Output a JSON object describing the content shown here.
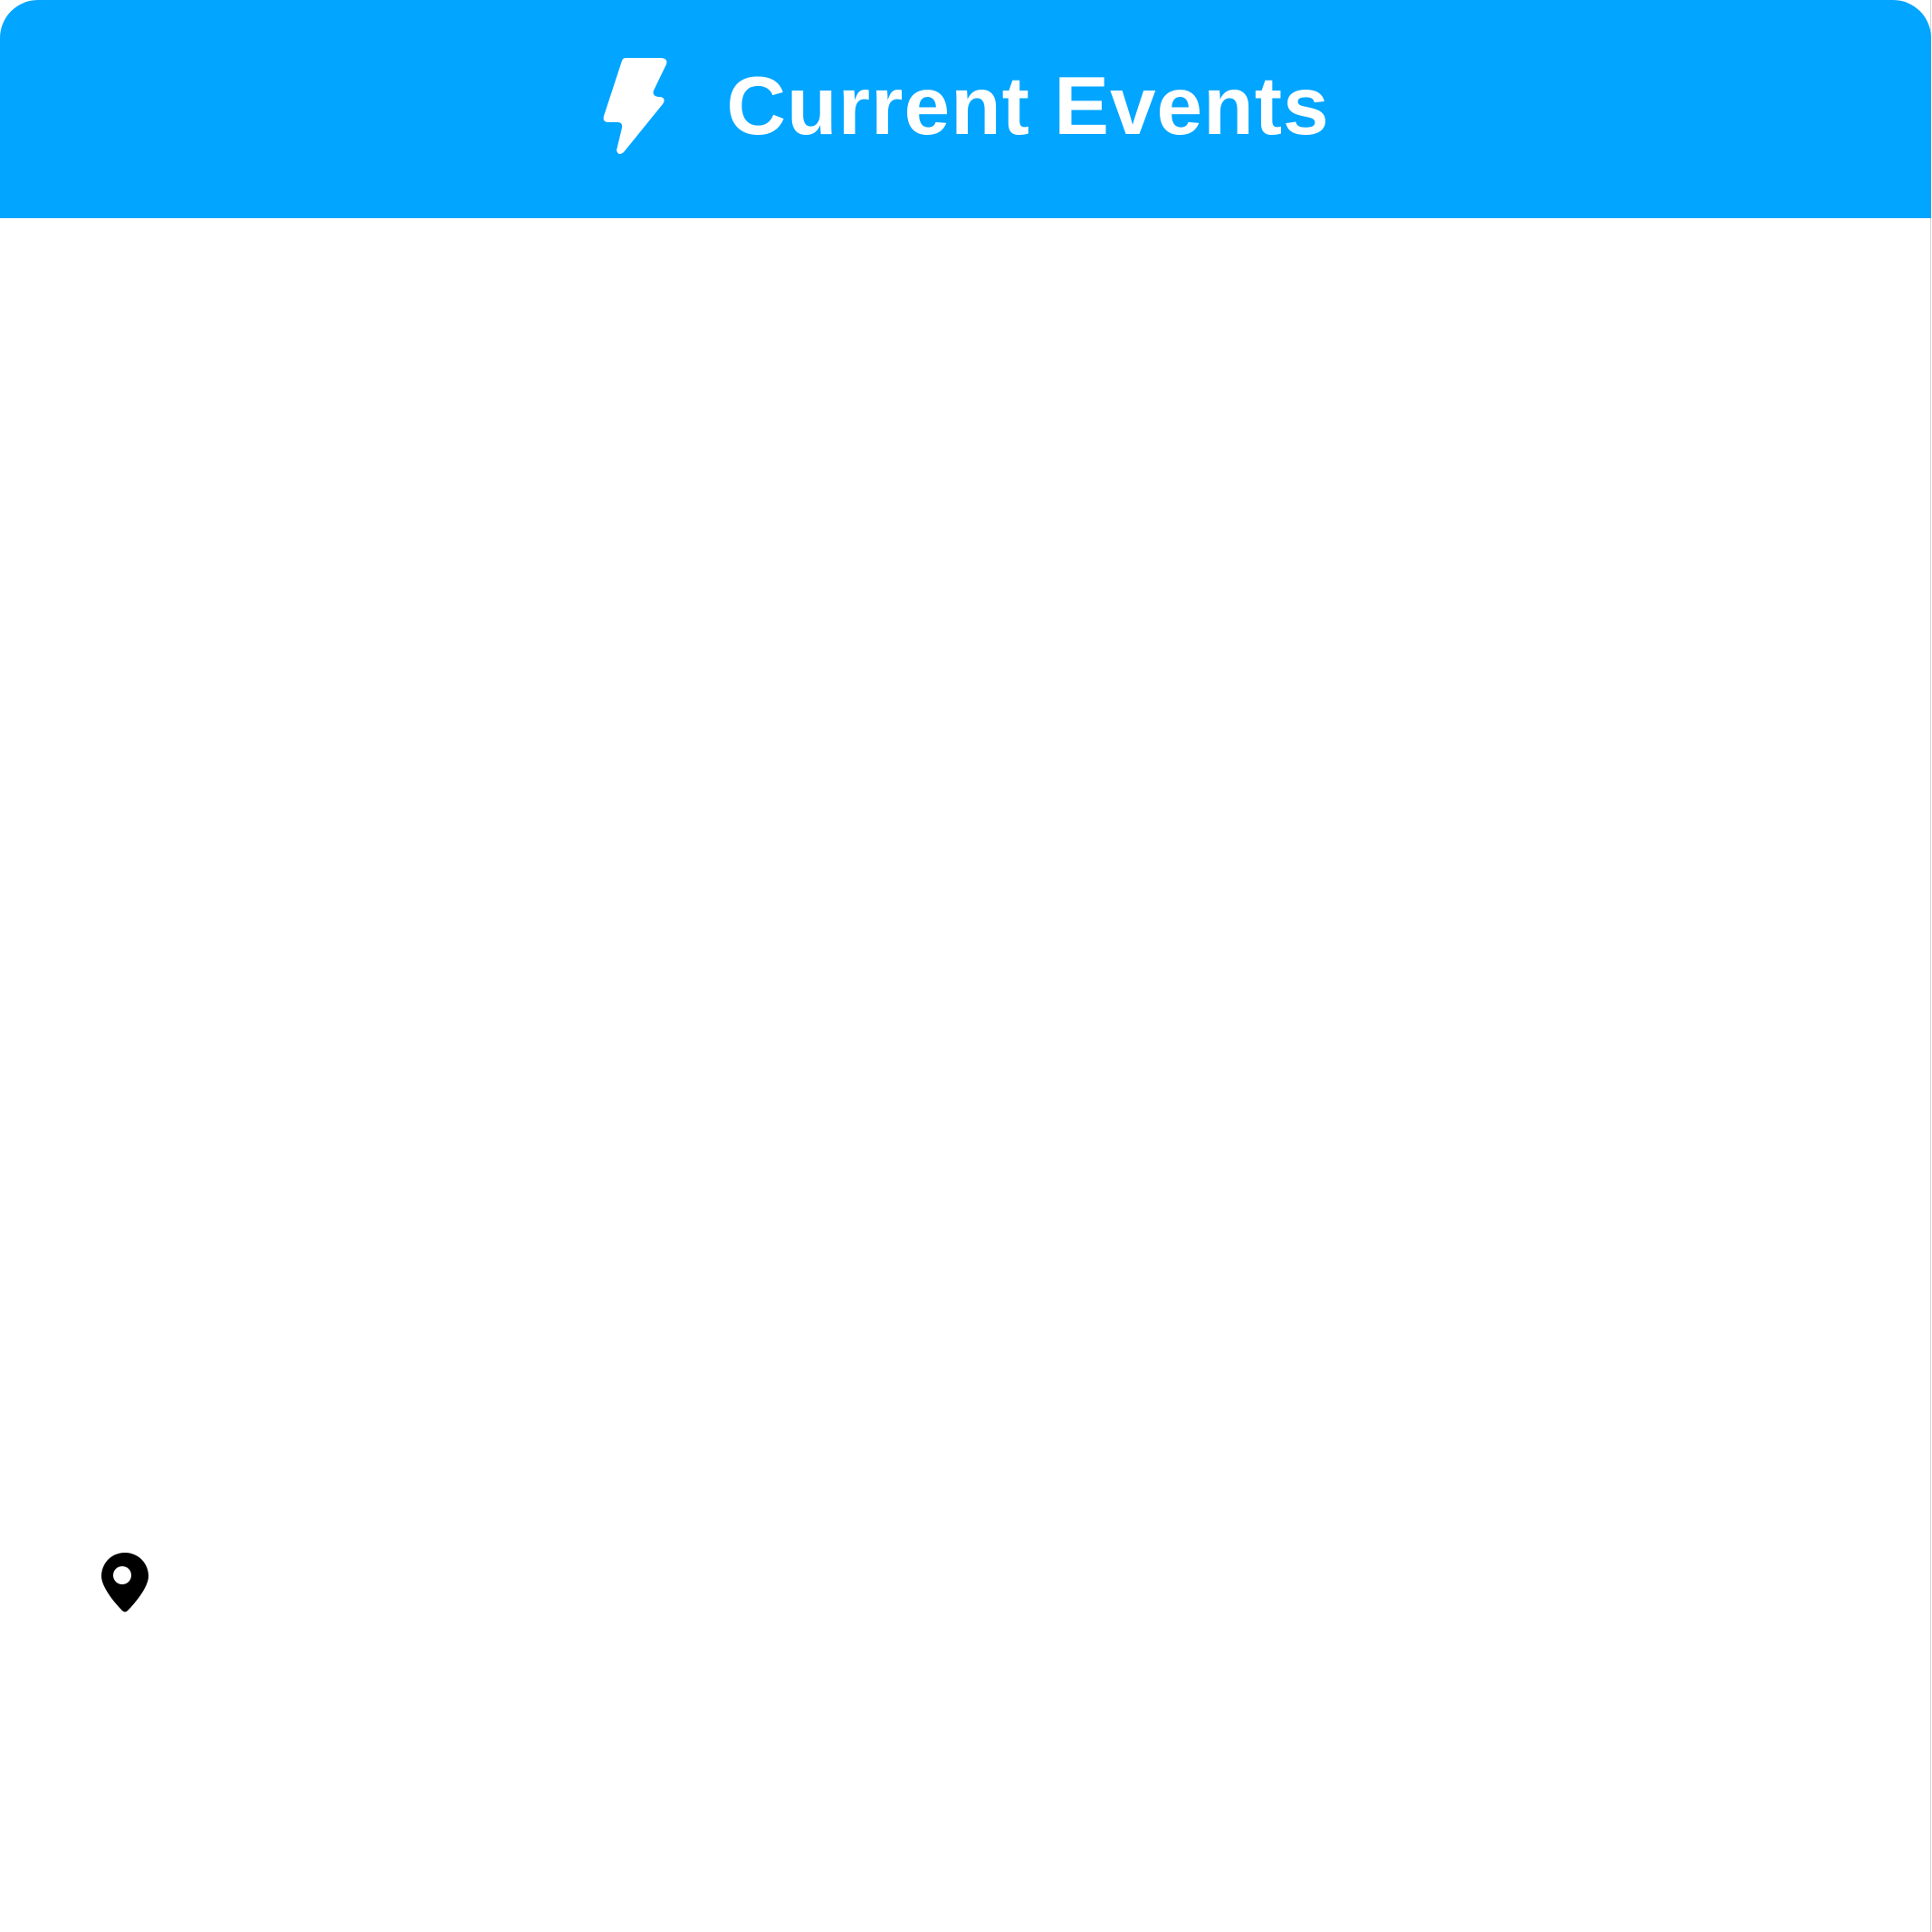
{
  "header": {
    "title": "Current Events",
    "icon": "lightning-bolt-icon",
    "background_color": "#02a5ff",
    "text_color": "#ffffff"
  },
  "content": {
    "location_icon": "map-pin-icon"
  }
}
